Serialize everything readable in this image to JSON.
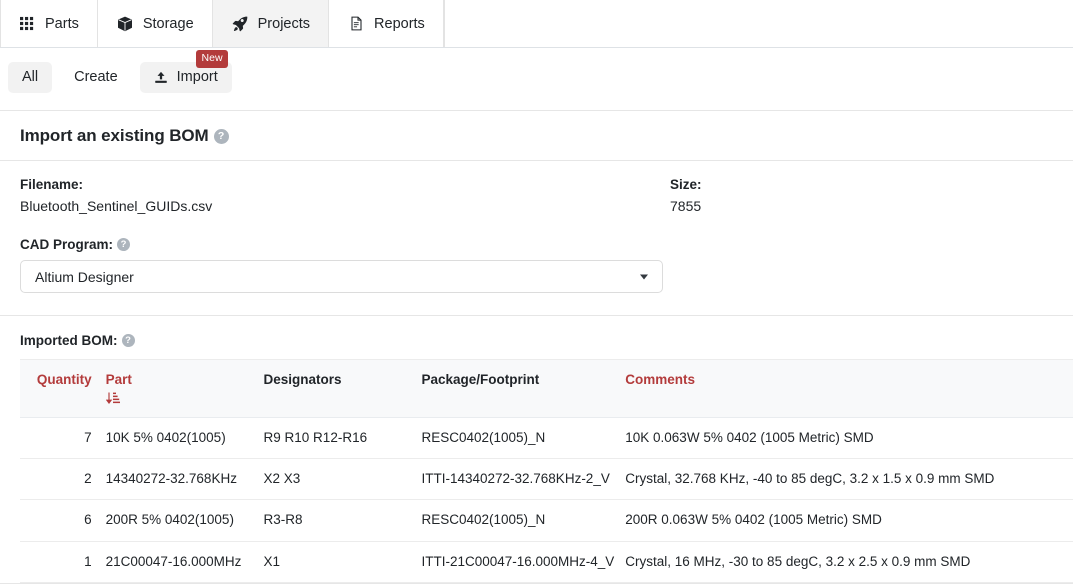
{
  "nav": {
    "tabs": [
      {
        "label": "Parts",
        "icon": "grid-icon",
        "active": false
      },
      {
        "label": "Storage",
        "icon": "box-icon",
        "active": false
      },
      {
        "label": "Projects",
        "icon": "rocket-icon",
        "active": true
      },
      {
        "label": "Reports",
        "icon": "file-icon",
        "active": false
      }
    ]
  },
  "subnav": {
    "all_label": "All",
    "create_label": "Create",
    "import_label": "Import",
    "import_badge": "New",
    "import_icon": "upload-icon",
    "badge_color": "#b33b3b"
  },
  "card": {
    "title": "Import an existing BOM",
    "help": "?",
    "filename_label": "Filename:",
    "filename_value": "Bluetooth_Sentinel_GUIDs.csv",
    "size_label": "Size:",
    "size_value": "7855",
    "cad_label": "CAD Program:",
    "cad_value": "Altium Designer",
    "bom_label": "Imported BOM:"
  },
  "table": {
    "columns": [
      {
        "label": "Quantity",
        "sortable": true
      },
      {
        "label": "Part",
        "sortable": true
      },
      {
        "label": "Designators",
        "sortable": false
      },
      {
        "label": "Package/Footprint",
        "sortable": false
      },
      {
        "label": "Comments",
        "sortable": true
      }
    ],
    "sort_column": "Part",
    "sort_direction": "descending",
    "header_color": "#b33b3b",
    "rows": [
      {
        "quantity": "7",
        "part": "10K 5% 0402(1005)",
        "designators": "R9 R10 R12-R16",
        "package": "RESC0402(1005)_N",
        "comments": "10K 0.063W 5% 0402 (1005 Metric) SMD"
      },
      {
        "quantity": "2",
        "part": "14340272-32.768KHz",
        "designators": "X2 X3",
        "package": "ITTI-14340272-32.768KHz-2_V",
        "comments": "Crystal, 32.768 KHz, -40 to 85 degC, 3.2 x 1.5 x 0.9 mm SMD"
      },
      {
        "quantity": "6",
        "part": "200R 5% 0402(1005)",
        "designators": "R3-R8",
        "package": "RESC0402(1005)_N",
        "comments": "200R 0.063W 5% 0402 (1005 Metric) SMD"
      },
      {
        "quantity": "1",
        "part": "21C00047-16.000MHz",
        "designators": "X1",
        "package": "ITTI-21C00047-16.000MHz-4_V",
        "comments": "Crystal, 16 MHz, -30 to 85 degC, 3.2 x 2.5 x 0.9 mm SMD"
      }
    ]
  }
}
